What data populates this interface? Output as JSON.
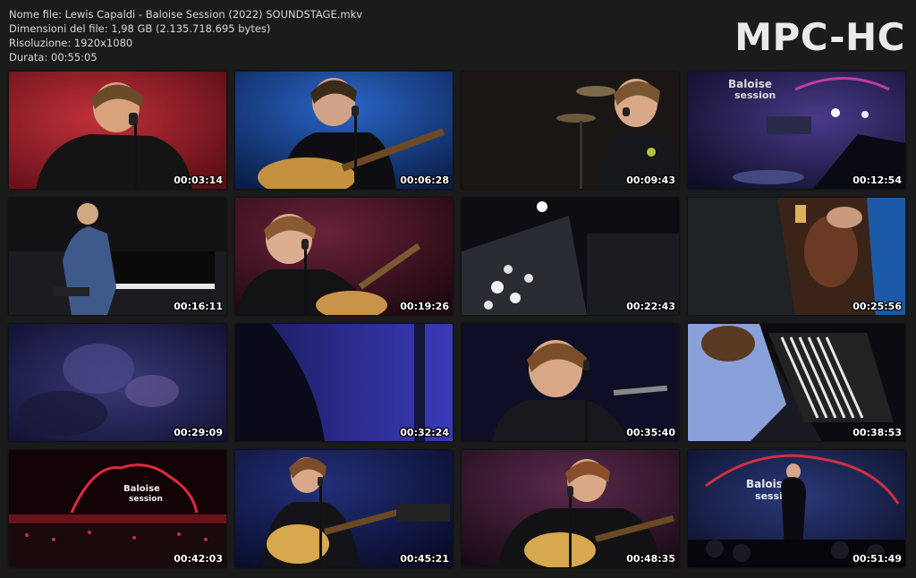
{
  "header": {
    "file_name": "Nome file: Lewis Capaldi - Baloise Session (2022) SOUNDSTAGE.mkv",
    "file_size": "Dimensioni del file: 1,98 GB (2.135.718.695 bytes)",
    "resolution": "Risoluzione: 1920x1080",
    "duration": "Durata: 00:55:05",
    "logo": "MPC-HC"
  },
  "thumbnails": [
    {
      "time": "00:03:14"
    },
    {
      "time": "00:06:28"
    },
    {
      "time": "00:09:43"
    },
    {
      "time": "00:12:54"
    },
    {
      "time": "00:16:11"
    },
    {
      "time": "00:19:26"
    },
    {
      "time": "00:22:43"
    },
    {
      "time": "00:25:56"
    },
    {
      "time": "00:29:09"
    },
    {
      "time": "00:32:24"
    },
    {
      "time": "00:35:40"
    },
    {
      "time": "00:38:53"
    },
    {
      "time": "00:42:03"
    },
    {
      "time": "00:45:21"
    },
    {
      "time": "00:48:35"
    },
    {
      "time": "00:51:49"
    }
  ]
}
